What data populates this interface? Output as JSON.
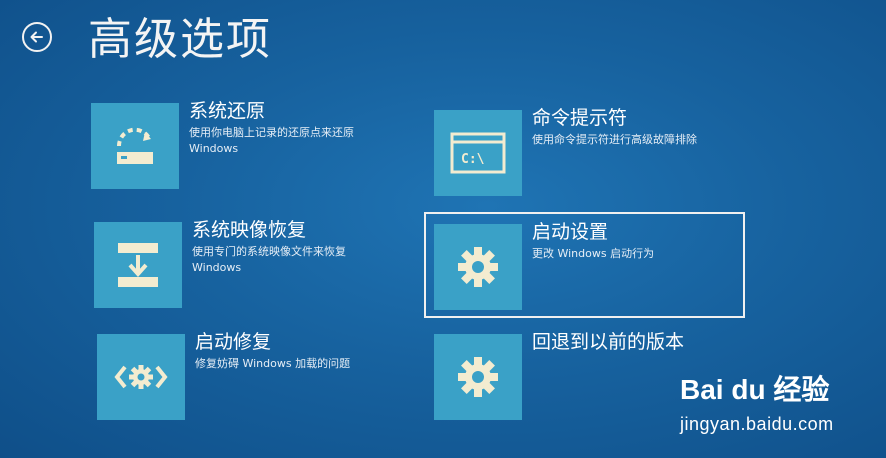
{
  "header": {
    "title": "高级选项",
    "back_icon": "back-arrow-icon"
  },
  "tiles": [
    {
      "title": "系统还原",
      "desc": "使用你电脑上记录的还原点来还原 Windows",
      "icon": "restore-icon"
    },
    {
      "title": "命令提示符",
      "desc": "使用命令提示符进行高级故障排除",
      "icon": "command-prompt-icon",
      "icon_text": "C:\\"
    },
    {
      "title": "系统映像恢复",
      "desc": "使用专门的系统映像文件来恢复 Windows",
      "icon": "image-recovery-icon"
    },
    {
      "title": "启动设置",
      "desc": "更改 Windows 启动行为",
      "icon": "gear-icon",
      "selected": true
    },
    {
      "title": "启动修复",
      "desc": "修复妨碍 Windows 加载的问题",
      "icon": "startup-repair-icon"
    },
    {
      "title": "回退到以前的版本",
      "desc": "",
      "icon": "gear-icon"
    }
  ],
  "watermark": {
    "brand": "Bai du 经验",
    "url": "jingyan.baidu.com"
  },
  "colors": {
    "background": "#17629f",
    "tile": "#3aa1c7",
    "icon": "#f3ecd0"
  }
}
